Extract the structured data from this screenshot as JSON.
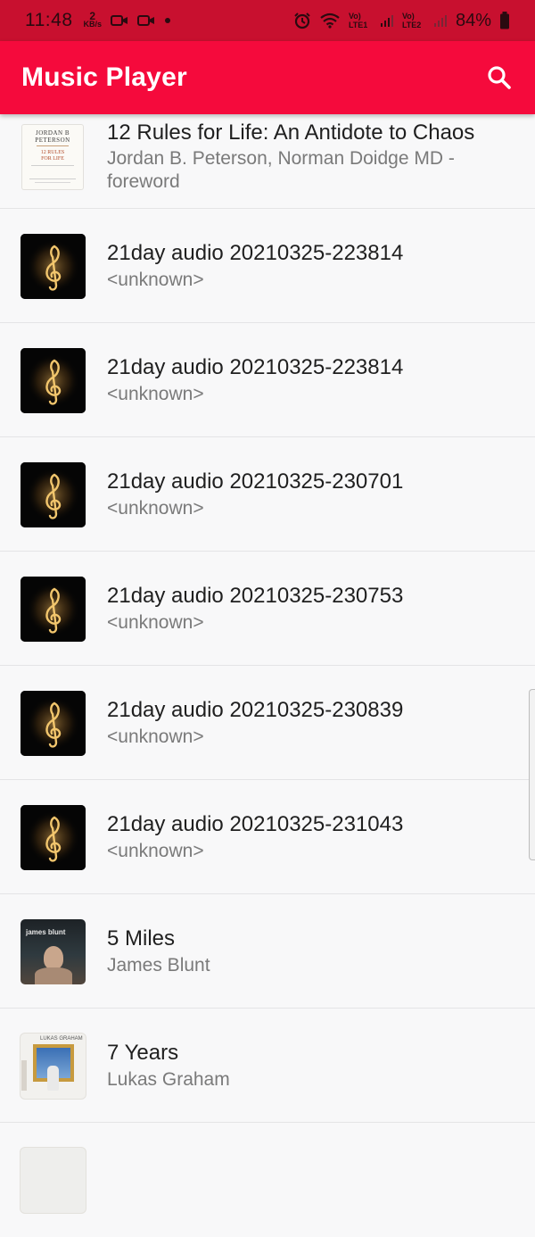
{
  "status_bar": {
    "time": "11:48",
    "speed_value": "2",
    "speed_unit": "KB/s",
    "volte1": "Vo) LTE1",
    "volte2": "Vo) LTE2",
    "battery": "84%"
  },
  "app_bar": {
    "title": "Music Player",
    "search_icon": "search-icon"
  },
  "tracks": [
    {
      "title": "12 Rules for Life: An Antidote to Chaos",
      "artist_line1": "Jordan B. Peterson, Norman Doidge MD -",
      "artist_line2": "foreword",
      "art": "book-cover",
      "cover_top": "JORDAN B",
      "cover_mid": "PETERSON",
      "cover_title1": "12 RULES",
      "cover_title2": "FOR LIFE"
    },
    {
      "title": "21day audio 20210325-223814",
      "artist": "<unknown>",
      "art": "music-note"
    },
    {
      "title": "21day audio 20210325-223814",
      "artist": "<unknown>",
      "art": "music-note"
    },
    {
      "title": "21day audio 20210325-230701",
      "artist": "<unknown>",
      "art": "music-note"
    },
    {
      "title": "21day audio 20210325-230753",
      "artist": "<unknown>",
      "art": "music-note"
    },
    {
      "title": "21day audio 20210325-230839",
      "artist": "<unknown>",
      "art": "music-note"
    },
    {
      "title": "21day audio 20210325-231043",
      "artist": "<unknown>",
      "art": "music-note"
    },
    {
      "title": "5 Miles",
      "artist": "James Blunt",
      "art": "album-photo",
      "cover_text": "james blunt"
    },
    {
      "title": "7 Years",
      "artist": "Lukas Graham",
      "art": "album-photo",
      "cover_text": "LUKAS GRAHAM"
    }
  ],
  "colors": {
    "status_bar": "#c8102f",
    "app_bar": "#f50a3c",
    "background": "#f8f8f9"
  }
}
